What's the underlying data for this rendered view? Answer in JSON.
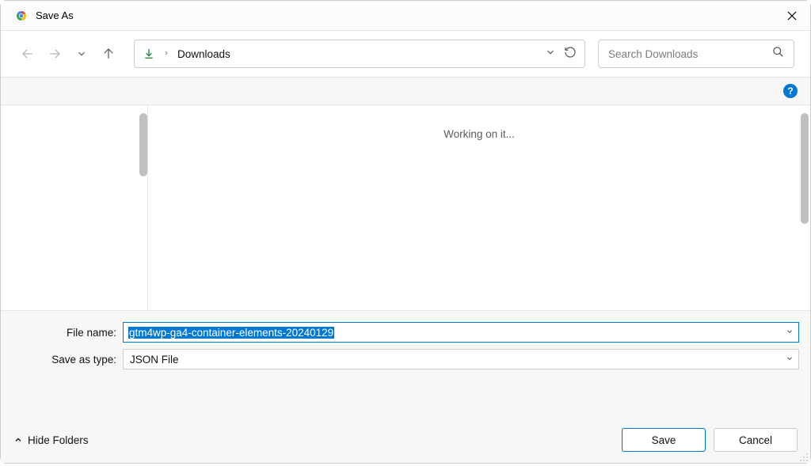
{
  "title": "Save As",
  "breadcrumb": {
    "location": "Downloads"
  },
  "search": {
    "placeholder": "Search Downloads"
  },
  "main": {
    "status_text": "Working on it..."
  },
  "form": {
    "filename_label": "File name:",
    "filename_value": "gtm4wp-ga4-container-elements-20240129",
    "filetype_label": "Save as type:",
    "filetype_value": "JSON File"
  },
  "footer": {
    "hide_folders_label": "Hide Folders",
    "save_label": "Save",
    "cancel_label": "Cancel"
  },
  "help_glyph": "?"
}
